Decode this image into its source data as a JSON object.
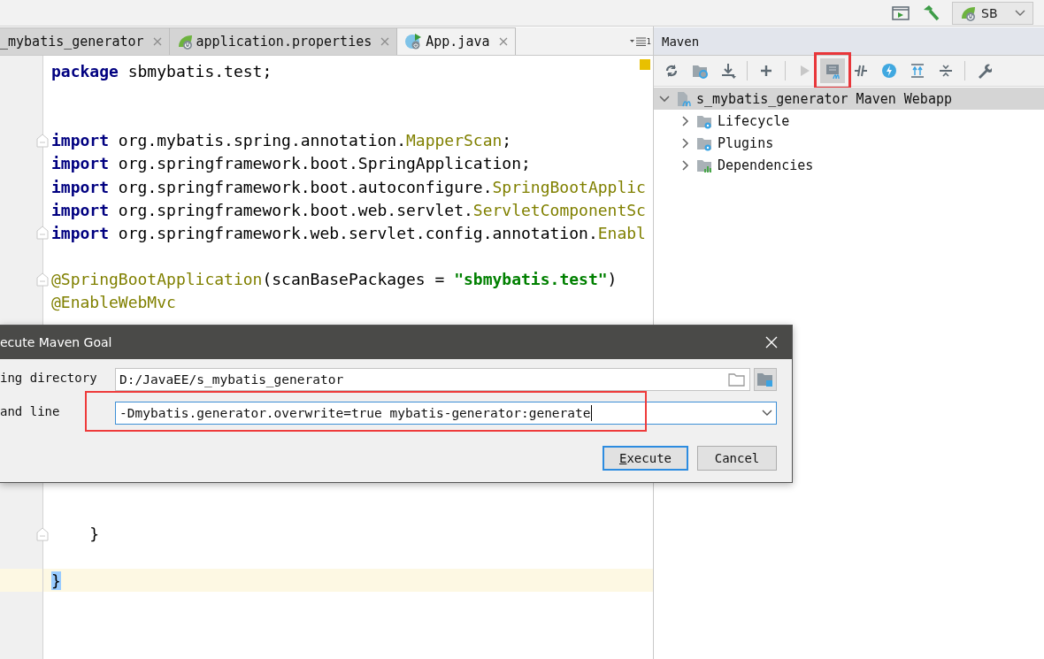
{
  "top_bar": {
    "run_config": {
      "label": "SB"
    }
  },
  "editor": {
    "tabs": [
      {
        "label": "_mybatis_generator",
        "kind": "plain",
        "selected": false
      },
      {
        "label": "application.properties",
        "kind": "spring",
        "selected": false
      },
      {
        "label": "App.java",
        "kind": "class",
        "selected": true
      }
    ],
    "tab_overflow_count": "1",
    "lines": [
      {
        "kind": "code",
        "tokens": [
          {
            "kind": "keyword",
            "text": "package"
          },
          {
            "kind": "plain",
            "text": " sbmybatis.test;"
          }
        ]
      },
      {
        "kind": "blank"
      },
      {
        "kind": "blank"
      },
      {
        "kind": "code",
        "fold": true,
        "tokens": [
          {
            "kind": "keyword",
            "text": "import"
          },
          {
            "kind": "plain",
            "text": " org.mybatis.spring.annotation."
          },
          {
            "kind": "annotation",
            "text": "MapperScan"
          },
          {
            "kind": "plain",
            "text": ";"
          }
        ]
      },
      {
        "kind": "code",
        "tokens": [
          {
            "kind": "keyword",
            "text": "import"
          },
          {
            "kind": "plain",
            "text": " org.springframework.boot.SpringApplication;"
          }
        ]
      },
      {
        "kind": "code",
        "tokens": [
          {
            "kind": "keyword",
            "text": "import"
          },
          {
            "kind": "plain",
            "text": " org.springframework.boot.autoconfigure."
          },
          {
            "kind": "annotation",
            "text": "SpringBootApplic"
          }
        ]
      },
      {
        "kind": "code",
        "tokens": [
          {
            "kind": "keyword",
            "text": "import"
          },
          {
            "kind": "plain",
            "text": " org.springframework.boot.web.servlet."
          },
          {
            "kind": "annotation",
            "text": "ServletComponentSc"
          }
        ]
      },
      {
        "kind": "code",
        "fold": true,
        "tokens": [
          {
            "kind": "keyword",
            "text": "import"
          },
          {
            "kind": "plain",
            "text": " org.springframework.web.servlet.config.annotation."
          },
          {
            "kind": "annotation",
            "text": "Enabl"
          }
        ]
      },
      {
        "kind": "blank"
      },
      {
        "kind": "code",
        "fold": true,
        "tokens": [
          {
            "kind": "annotation",
            "text": "@SpringBootApplication"
          },
          {
            "kind": "plain",
            "text": "(scanBasePackages = "
          },
          {
            "kind": "string",
            "text": "\"sbmybatis.test\""
          },
          {
            "kind": "plain",
            "text": ")"
          }
        ]
      },
      {
        "kind": "code",
        "tokens": [
          {
            "kind": "annotation",
            "text": "@EnableWebMvc"
          }
        ]
      },
      {
        "kind": "blank"
      },
      {
        "kind": "blank"
      },
      {
        "kind": "blank"
      },
      {
        "kind": "blank"
      },
      {
        "kind": "blank"
      },
      {
        "kind": "blank"
      },
      {
        "kind": "blank"
      },
      {
        "kind": "blank"
      },
      {
        "kind": "blank"
      },
      {
        "kind": "code",
        "fold": true,
        "tokens": [
          {
            "kind": "plain",
            "text": "    }"
          }
        ]
      },
      {
        "kind": "blank"
      },
      {
        "kind": "code",
        "current": true,
        "tokens": [
          {
            "kind": "brace-match",
            "text": "}"
          }
        ]
      }
    ]
  },
  "maven": {
    "title": "Maven",
    "toolbar": [
      {
        "kind": "button",
        "highlighted": false
      },
      {
        "kind": "button",
        "highlighted": false
      },
      {
        "kind": "button",
        "highlighted": false
      },
      {
        "kind": "separator"
      },
      {
        "kind": "button",
        "highlighted": false
      },
      {
        "kind": "separator"
      },
      {
        "kind": "button",
        "highlighted": false
      },
      {
        "kind": "button",
        "highlighted": true
      },
      {
        "kind": "button",
        "highlighted": false
      },
      {
        "kind": "button",
        "highlighted": false
      },
      {
        "kind": "button",
        "highlighted": false
      },
      {
        "kind": "button",
        "highlighted": false
      },
      {
        "kind": "separator"
      },
      {
        "kind": "button",
        "highlighted": false
      }
    ],
    "tree": [
      {
        "label": "s_mybatis_generator Maven Webapp",
        "kind": "project",
        "expanded": true,
        "selected": true,
        "children": [
          {
            "label": "Lifecycle",
            "kind": "folder",
            "expanded": false,
            "selected": false
          },
          {
            "label": "Plugins",
            "kind": "folder",
            "expanded": false,
            "selected": false
          },
          {
            "label": "Dependencies",
            "kind": "dependencies",
            "expanded": false,
            "selected": false
          }
        ]
      }
    ]
  },
  "dialog": {
    "title": "ecute Maven Goal",
    "fields": [
      {
        "label": "ing directory",
        "kind": "path",
        "value": "D:/JavaEE/s_mybatis_generator",
        "focused": false
      },
      {
        "label": "and line",
        "kind": "combo",
        "value": "-Dmybatis.generator.overwrite=true mybatis-generator:generate",
        "focused": true,
        "highlighted": true
      }
    ],
    "buttons": [
      {
        "label": "Execute",
        "default": true,
        "mnemonic": true
      },
      {
        "label": "Cancel",
        "default": false,
        "mnemonic": false
      }
    ]
  }
}
